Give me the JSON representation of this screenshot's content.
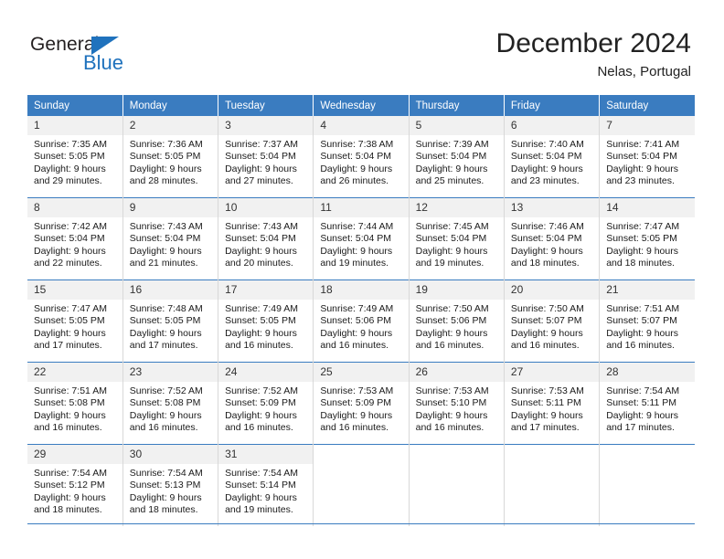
{
  "brand": {
    "name_dark": "General",
    "name_blue": "Blue",
    "accent_color": "#1f72bd"
  },
  "header": {
    "title": "December 2024",
    "subtitle": "Nelas, Portugal",
    "header_bg": "#3a7cc0",
    "daynum_bg": "#f1f1f1"
  },
  "weekday_headers": [
    "Sunday",
    "Monday",
    "Tuesday",
    "Wednesday",
    "Thursday",
    "Friday",
    "Saturday"
  ],
  "weeks": [
    [
      {
        "day": "1",
        "sunrise": "Sunrise: 7:35 AM",
        "sunset": "Sunset: 5:05 PM",
        "daylight1": "Daylight: 9 hours",
        "daylight2": "and 29 minutes."
      },
      {
        "day": "2",
        "sunrise": "Sunrise: 7:36 AM",
        "sunset": "Sunset: 5:05 PM",
        "daylight1": "Daylight: 9 hours",
        "daylight2": "and 28 minutes."
      },
      {
        "day": "3",
        "sunrise": "Sunrise: 7:37 AM",
        "sunset": "Sunset: 5:04 PM",
        "daylight1": "Daylight: 9 hours",
        "daylight2": "and 27 minutes."
      },
      {
        "day": "4",
        "sunrise": "Sunrise: 7:38 AM",
        "sunset": "Sunset: 5:04 PM",
        "daylight1": "Daylight: 9 hours",
        "daylight2": "and 26 minutes."
      },
      {
        "day": "5",
        "sunrise": "Sunrise: 7:39 AM",
        "sunset": "Sunset: 5:04 PM",
        "daylight1": "Daylight: 9 hours",
        "daylight2": "and 25 minutes."
      },
      {
        "day": "6",
        "sunrise": "Sunrise: 7:40 AM",
        "sunset": "Sunset: 5:04 PM",
        "daylight1": "Daylight: 9 hours",
        "daylight2": "and 23 minutes."
      },
      {
        "day": "7",
        "sunrise": "Sunrise: 7:41 AM",
        "sunset": "Sunset: 5:04 PM",
        "daylight1": "Daylight: 9 hours",
        "daylight2": "and 23 minutes."
      }
    ],
    [
      {
        "day": "8",
        "sunrise": "Sunrise: 7:42 AM",
        "sunset": "Sunset: 5:04 PM",
        "daylight1": "Daylight: 9 hours",
        "daylight2": "and 22 minutes."
      },
      {
        "day": "9",
        "sunrise": "Sunrise: 7:43 AM",
        "sunset": "Sunset: 5:04 PM",
        "daylight1": "Daylight: 9 hours",
        "daylight2": "and 21 minutes."
      },
      {
        "day": "10",
        "sunrise": "Sunrise: 7:43 AM",
        "sunset": "Sunset: 5:04 PM",
        "daylight1": "Daylight: 9 hours",
        "daylight2": "and 20 minutes."
      },
      {
        "day": "11",
        "sunrise": "Sunrise: 7:44 AM",
        "sunset": "Sunset: 5:04 PM",
        "daylight1": "Daylight: 9 hours",
        "daylight2": "and 19 minutes."
      },
      {
        "day": "12",
        "sunrise": "Sunrise: 7:45 AM",
        "sunset": "Sunset: 5:04 PM",
        "daylight1": "Daylight: 9 hours",
        "daylight2": "and 19 minutes."
      },
      {
        "day": "13",
        "sunrise": "Sunrise: 7:46 AM",
        "sunset": "Sunset: 5:04 PM",
        "daylight1": "Daylight: 9 hours",
        "daylight2": "and 18 minutes."
      },
      {
        "day": "14",
        "sunrise": "Sunrise: 7:47 AM",
        "sunset": "Sunset: 5:05 PM",
        "daylight1": "Daylight: 9 hours",
        "daylight2": "and 18 minutes."
      }
    ],
    [
      {
        "day": "15",
        "sunrise": "Sunrise: 7:47 AM",
        "sunset": "Sunset: 5:05 PM",
        "daylight1": "Daylight: 9 hours",
        "daylight2": "and 17 minutes."
      },
      {
        "day": "16",
        "sunrise": "Sunrise: 7:48 AM",
        "sunset": "Sunset: 5:05 PM",
        "daylight1": "Daylight: 9 hours",
        "daylight2": "and 17 minutes."
      },
      {
        "day": "17",
        "sunrise": "Sunrise: 7:49 AM",
        "sunset": "Sunset: 5:05 PM",
        "daylight1": "Daylight: 9 hours",
        "daylight2": "and 16 minutes."
      },
      {
        "day": "18",
        "sunrise": "Sunrise: 7:49 AM",
        "sunset": "Sunset: 5:06 PM",
        "daylight1": "Daylight: 9 hours",
        "daylight2": "and 16 minutes."
      },
      {
        "day": "19",
        "sunrise": "Sunrise: 7:50 AM",
        "sunset": "Sunset: 5:06 PM",
        "daylight1": "Daylight: 9 hours",
        "daylight2": "and 16 minutes."
      },
      {
        "day": "20",
        "sunrise": "Sunrise: 7:50 AM",
        "sunset": "Sunset: 5:07 PM",
        "daylight1": "Daylight: 9 hours",
        "daylight2": "and 16 minutes."
      },
      {
        "day": "21",
        "sunrise": "Sunrise: 7:51 AM",
        "sunset": "Sunset: 5:07 PM",
        "daylight1": "Daylight: 9 hours",
        "daylight2": "and 16 minutes."
      }
    ],
    [
      {
        "day": "22",
        "sunrise": "Sunrise: 7:51 AM",
        "sunset": "Sunset: 5:08 PM",
        "daylight1": "Daylight: 9 hours",
        "daylight2": "and 16 minutes."
      },
      {
        "day": "23",
        "sunrise": "Sunrise: 7:52 AM",
        "sunset": "Sunset: 5:08 PM",
        "daylight1": "Daylight: 9 hours",
        "daylight2": "and 16 minutes."
      },
      {
        "day": "24",
        "sunrise": "Sunrise: 7:52 AM",
        "sunset": "Sunset: 5:09 PM",
        "daylight1": "Daylight: 9 hours",
        "daylight2": "and 16 minutes."
      },
      {
        "day": "25",
        "sunrise": "Sunrise: 7:53 AM",
        "sunset": "Sunset: 5:09 PM",
        "daylight1": "Daylight: 9 hours",
        "daylight2": "and 16 minutes."
      },
      {
        "day": "26",
        "sunrise": "Sunrise: 7:53 AM",
        "sunset": "Sunset: 5:10 PM",
        "daylight1": "Daylight: 9 hours",
        "daylight2": "and 16 minutes."
      },
      {
        "day": "27",
        "sunrise": "Sunrise: 7:53 AM",
        "sunset": "Sunset: 5:11 PM",
        "daylight1": "Daylight: 9 hours",
        "daylight2": "and 17 minutes."
      },
      {
        "day": "28",
        "sunrise": "Sunrise: 7:54 AM",
        "sunset": "Sunset: 5:11 PM",
        "daylight1": "Daylight: 9 hours",
        "daylight2": "and 17 minutes."
      }
    ],
    [
      {
        "day": "29",
        "sunrise": "Sunrise: 7:54 AM",
        "sunset": "Sunset: 5:12 PM",
        "daylight1": "Daylight: 9 hours",
        "daylight2": "and 18 minutes."
      },
      {
        "day": "30",
        "sunrise": "Sunrise: 7:54 AM",
        "sunset": "Sunset: 5:13 PM",
        "daylight1": "Daylight: 9 hours",
        "daylight2": "and 18 minutes."
      },
      {
        "day": "31",
        "sunrise": "Sunrise: 7:54 AM",
        "sunset": "Sunset: 5:14 PM",
        "daylight1": "Daylight: 9 hours",
        "daylight2": "and 19 minutes."
      },
      {
        "day": "",
        "sunrise": "",
        "sunset": "",
        "daylight1": "",
        "daylight2": ""
      },
      {
        "day": "",
        "sunrise": "",
        "sunset": "",
        "daylight1": "",
        "daylight2": ""
      },
      {
        "day": "",
        "sunrise": "",
        "sunset": "",
        "daylight1": "",
        "daylight2": ""
      },
      {
        "day": "",
        "sunrise": "",
        "sunset": "",
        "daylight1": "",
        "daylight2": ""
      }
    ]
  ]
}
